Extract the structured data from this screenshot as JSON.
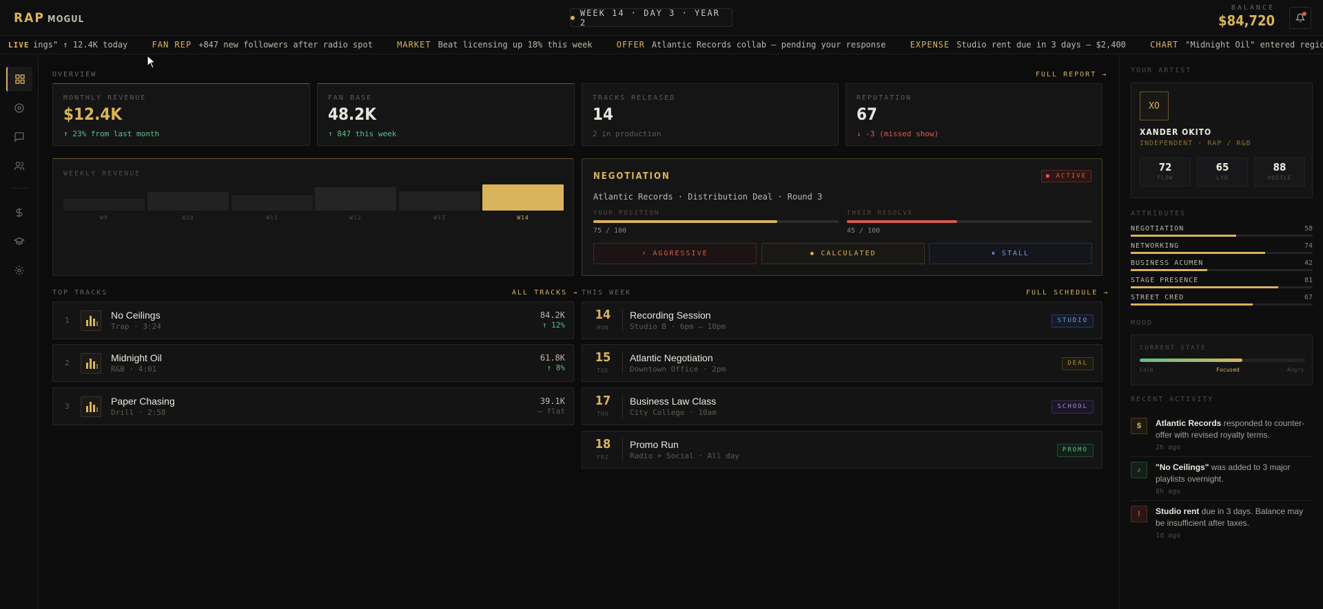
{
  "header": {
    "logo_primary": "RAP",
    "logo_secondary": "MOGUL",
    "week_info": "WEEK 14 · DAY 3 · YEAR 2",
    "balance_label": "BALANCE",
    "balance_value": "$84,720"
  },
  "ticker": {
    "live_label": "LIVE",
    "items": [
      {
        "tag": "",
        "text": "ings\" ↑ 12.4K  today"
      },
      {
        "tag": "FAN REP",
        "text": "+847 new followers after radio spot"
      },
      {
        "tag": "MARKET",
        "text": "Beat licensing up 18%  this week"
      },
      {
        "tag": "OFFER",
        "text": "Atlantic Records collab — pending your response"
      },
      {
        "tag": "EXPENSE",
        "text": "Studio rent due in 3 days  — $2,400"
      },
      {
        "tag": "CHART",
        "text": "\"Midnight Oil\" entered regior"
      }
    ]
  },
  "overview": {
    "title": "OVERVIEW",
    "link": "FULL REPORT →",
    "stats": [
      {
        "label": "MONTHLY REVENUE",
        "value": "$12.4K",
        "sub": "↑ 23% from last month"
      },
      {
        "label": "FAN BASE",
        "value": "48.2K",
        "sub": "↑ 847 this week"
      },
      {
        "label": "TRACKS RELEASED",
        "value": "14",
        "sub": "2 in production"
      },
      {
        "label": "REPUTATION",
        "value": "67",
        "sub": "↓ -3 (missed show)"
      }
    ]
  },
  "weekly_revenue": {
    "title": "WEEKLY REVENUE",
    "weeks": [
      "W9",
      "W10",
      "W11",
      "W12",
      "W13",
      "W14"
    ]
  },
  "negotiation": {
    "title": "NEGOTIATION",
    "badge": "● ACTIVE",
    "desc": "Atlantic Records · Distribution Deal · Round 3",
    "your_label": "YOUR POSITION",
    "your_value": "75 / 100",
    "your_pct": 75,
    "their_label": "THEIR RESOLVE",
    "their_value": "45 / 100",
    "their_pct": 45,
    "actions": [
      "⚡ AGGRESSIVE",
      "◆ CALCULATED",
      "⏸ STALL"
    ]
  },
  "top_tracks": {
    "title": "TOP TRACKS",
    "link": "ALL TRACKS →",
    "rows": [
      {
        "num": "1",
        "name": "No Ceilings",
        "meta": "Trap · 3:24",
        "plays": "84.2K",
        "change": "↑ 12%"
      },
      {
        "num": "2",
        "name": "Midnight Oil",
        "meta": "R&B · 4:01",
        "plays": "61.8K",
        "change": "↑ 8%"
      },
      {
        "num": "3",
        "name": "Paper Chasing",
        "meta": "Drill · 2:58",
        "plays": "39.1K",
        "change": "— flat"
      }
    ]
  },
  "this_week": {
    "title": "THIS WEEK",
    "link": "FULL SCHEDULE →",
    "rows": [
      {
        "day": "14",
        "dow": "MON",
        "name": "Recording Session",
        "meta": "Studio B · 6pm – 10pm",
        "tag": "STUDIO"
      },
      {
        "day": "15",
        "dow": "TUE",
        "name": "Atlantic Negotiation",
        "meta": "Downtown Office · 2pm",
        "tag": "DEAL"
      },
      {
        "day": "17",
        "dow": "THU",
        "name": "Business Law Class",
        "meta": "City College · 10am",
        "tag": "SCHOOL"
      },
      {
        "day": "18",
        "dow": "FRI",
        "name": "Promo Run",
        "meta": "Radio + Social · All day",
        "tag": "PROMO"
      }
    ]
  },
  "artist": {
    "section": "YOUR ARTIST",
    "initials": "XO",
    "name": "XANDER OKITO",
    "genre": "INDEPENDENT · RAP / R&B",
    "stats": [
      {
        "value": "72",
        "label": "FLOW"
      },
      {
        "value": "65",
        "label": "LYR"
      },
      {
        "value": "88",
        "label": "HUSTLE"
      }
    ]
  },
  "attributes": {
    "section": "ATTRIBUTES",
    "items": [
      {
        "name": "NEGOTIATION",
        "value": "58"
      },
      {
        "name": "NETWORKING",
        "value": "74"
      },
      {
        "name": "BUSINESS ACUMEN",
        "value": "42"
      },
      {
        "name": "STAGE PRESENCE",
        "value": "81"
      },
      {
        "name": "STREET CRED",
        "value": "67"
      }
    ]
  },
  "mood": {
    "section": "MOOD",
    "label": "CURRENT STATE",
    "left": "Calm",
    "current": "Focused",
    "right": "Angry",
    "level": 0.62
  },
  "activity": {
    "section": "RECENT ACTIVITY",
    "items": [
      {
        "icon": "$",
        "bold": "Atlantic Records",
        "text": " responded to counter-offer with revised royalty terms.",
        "time": "2h ago"
      },
      {
        "icon": "♪",
        "bold": "\"No Ceilings\"",
        "text": " was added to 3 major playlists overnight.",
        "time": "8h ago"
      },
      {
        "icon": "!",
        "bold": "Studio rent",
        "text": " due in 3 days. Balance may be insufficient after taxes.",
        "time": "1d ago"
      }
    ]
  },
  "colors": {
    "accent": "#d9b45a",
    "positive": "#5fbf8a",
    "negative": "#d9594f",
    "background": "#0c0c0d"
  }
}
